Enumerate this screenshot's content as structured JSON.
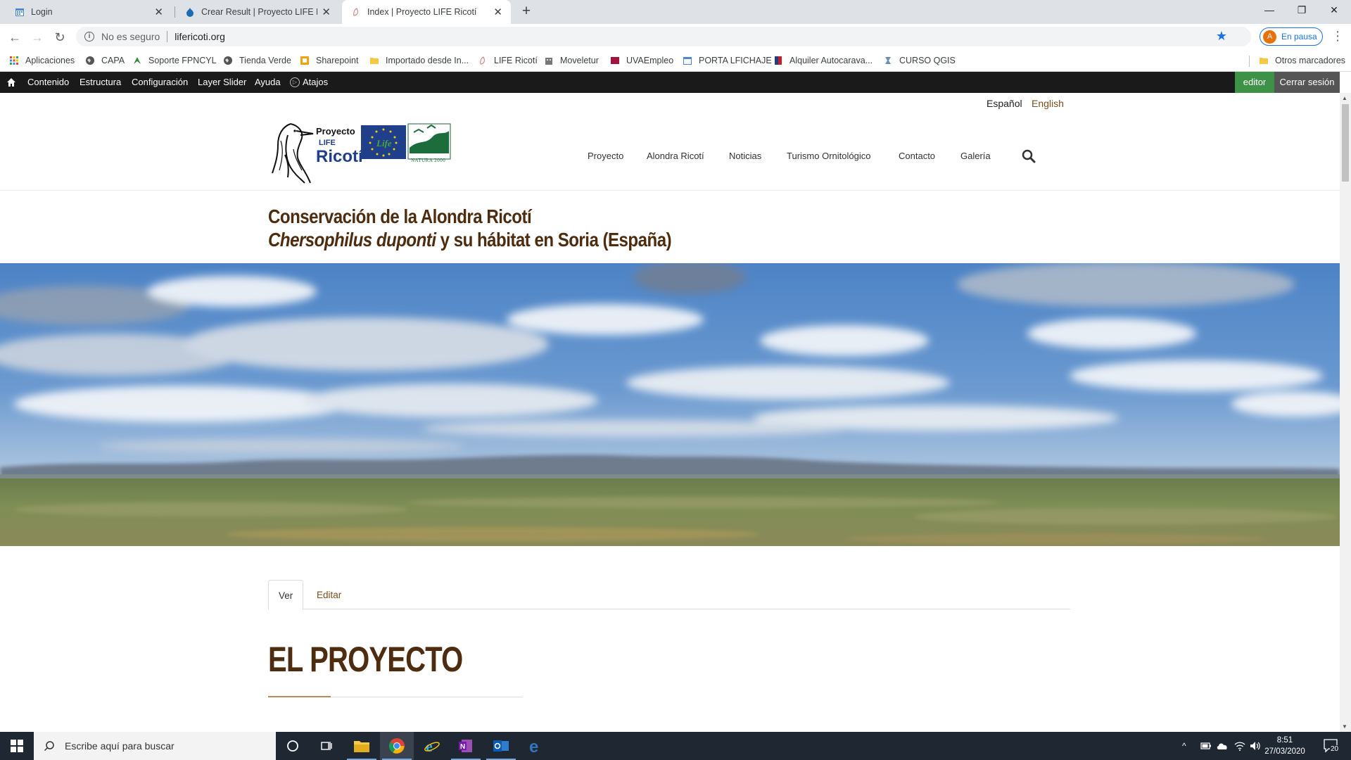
{
  "browser": {
    "tabs": [
      {
        "title": "Login",
        "active": false
      },
      {
        "title": "Crear Result | Proyecto LIFE Ricotí",
        "active": false
      },
      {
        "title": "Index | Proyecto LIFE Ricotí",
        "active": true
      }
    ],
    "new_tab_label": "+",
    "address": {
      "security_label": "No es seguro",
      "url": "lifericoti.org"
    },
    "profile": {
      "initial": "A",
      "status": "En pausa"
    },
    "bookmarks": [
      "Aplicaciones",
      "CAPA",
      "Soporte FPNCYL",
      "Tienda Verde",
      "Sharepoint",
      "Importado desde In...",
      "LIFE Ricotí",
      "Moveletur",
      "UVAEmpleo",
      "PORTA LFICHAJE",
      "Alquiler Autocarava...",
      "CURSO QGIS"
    ],
    "other_bookmarks": "Otros marcadores"
  },
  "admin_toolbar": {
    "items": [
      "Contenido",
      "Estructura",
      "Configuración",
      "Layer Slider",
      "Ayuda",
      "Atajos"
    ],
    "user": "editor",
    "logout": "Cerrar sesión"
  },
  "site": {
    "languages": [
      "Español",
      "English"
    ],
    "logo": {
      "line1": "Proyecto",
      "line2": "LIFE",
      "line3": "Ricotí",
      "natura": "NATURA 2000",
      "life": "Life"
    },
    "nav": [
      "Proyecto",
      "Alondra Ricotí",
      "Noticias",
      "Turismo Ornitológico",
      "Contacto",
      "Galería"
    ],
    "subtitle_line1": "Conservación de la Alondra Ricotí",
    "subtitle_line2_italic": "Chersophilus duponti",
    "subtitle_line2_rest": " y su hábitat en Soria (España)",
    "tabs": [
      "Ver",
      "Editar"
    ],
    "heading": "EL PROYECTO"
  },
  "taskbar": {
    "search_placeholder": "Escribe aquí para buscar",
    "time": "8:51",
    "date": "27/03/2020",
    "notification_count": "20"
  },
  "colors": {
    "brand_brown": "#4e2c0f",
    "link_brown": "#7a4e1c",
    "accent_tan": "#b58a57",
    "admin_green": "#3e9247"
  }
}
